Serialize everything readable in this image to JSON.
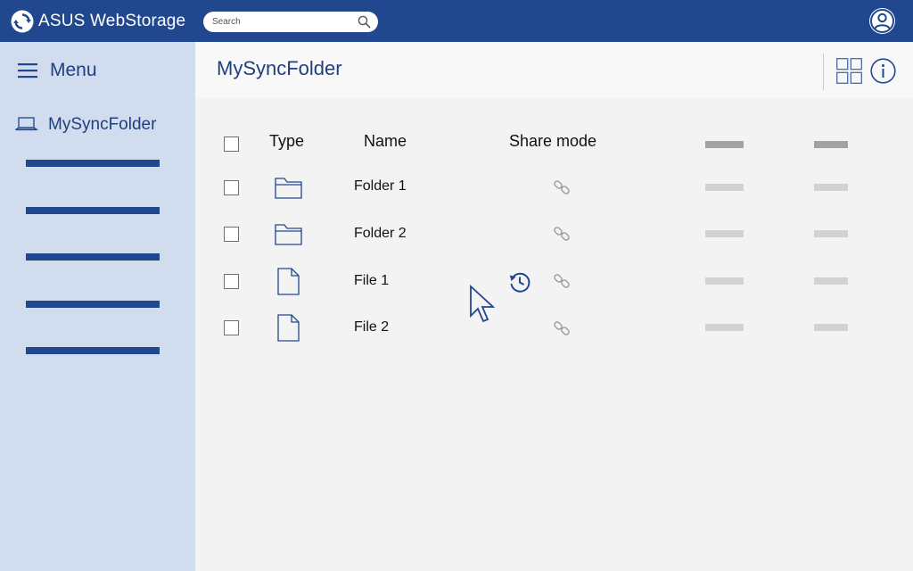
{
  "app": {
    "title": "ASUS WebStorage",
    "brand_color": "#21478f",
    "sidebar_color": "#d1dcee"
  },
  "search": {
    "placeholder": "Search",
    "icon": "search-icon"
  },
  "header": {
    "user_icon": "user-icon"
  },
  "sidebar": {
    "menu_label": "Menu",
    "menu_icon": "hamburger-icon",
    "folder_label": "MySyncFolder",
    "folder_icon": "laptop-icon",
    "placeholder_items": 5
  },
  "main": {
    "title": "MySyncFolder",
    "view_icons": [
      "grid-view-icon",
      "info-icon"
    ]
  },
  "table": {
    "columns": [
      "Type",
      "Name",
      "Share mode"
    ],
    "rows": [
      {
        "type": "folder",
        "name": "Folder 1"
      },
      {
        "type": "folder",
        "name": "Folder 2"
      },
      {
        "type": "file",
        "name": "File 1",
        "history": true
      },
      {
        "type": "file",
        "name": "File 2"
      }
    ]
  }
}
